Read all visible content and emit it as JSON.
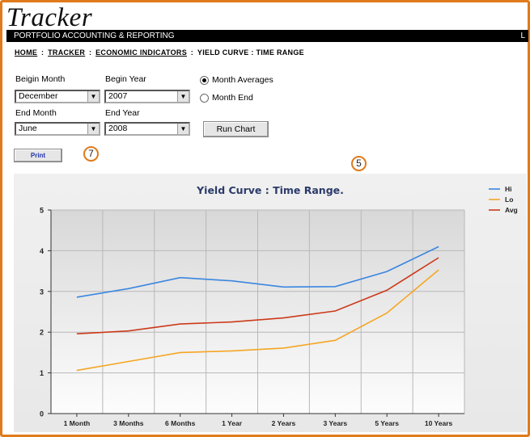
{
  "app": {
    "logo": "Tracker",
    "subtitle": "PORTFOLIO ACCOUNTING & REPORTING",
    "topbar_right": "L"
  },
  "breadcrumb": {
    "home": "HOME",
    "tracker": "TRACKER",
    "economic_indicators": "ECONOMIC INDICATORS",
    "current": "YIELD CURVE : TIME RANGE"
  },
  "form": {
    "begin_month_label": "Beigin Month",
    "begin_month_value": "December",
    "begin_year_label": "Begin Year",
    "begin_year_value": "2007",
    "end_month_label": "End Month",
    "end_month_value": "June",
    "end_year_label": "End Year",
    "end_year_value": "2008",
    "radio_month_averages": "Month Averages",
    "radio_month_end": "Month End",
    "selected_radio": "Month Averages",
    "run_chart_label": "Run Chart",
    "print_label": "Print"
  },
  "badges": {
    "badge_a": "7",
    "badge_b": "5"
  },
  "chart_data": {
    "type": "line",
    "title": "Yield Curve : Time Range.",
    "categories": [
      "1 Month",
      "3 Months",
      "6 Months",
      "1 Year",
      "2 Years",
      "3 Years",
      "5 Years",
      "10 Years"
    ],
    "ylim": [
      0,
      5
    ],
    "yticks": [
      "0",
      "1",
      "2",
      "3",
      "4",
      "5"
    ],
    "grid": true,
    "legend_position": "top-right",
    "series": [
      {
        "name": "Hi",
        "color": "#3a86e0",
        "values": [
          2.86,
          3.07,
          3.34,
          3.26,
          3.11,
          3.12,
          3.49,
          4.1
        ]
      },
      {
        "name": "Lo",
        "color": "#f5a623",
        "values": [
          1.06,
          1.28,
          1.5,
          1.54,
          1.61,
          1.8,
          2.47,
          3.53
        ]
      },
      {
        "name": "Avg",
        "color": "#cc3a1a",
        "values": [
          1.96,
          2.03,
          2.2,
          2.25,
          2.35,
          2.52,
          3.03,
          3.83
        ]
      }
    ]
  }
}
